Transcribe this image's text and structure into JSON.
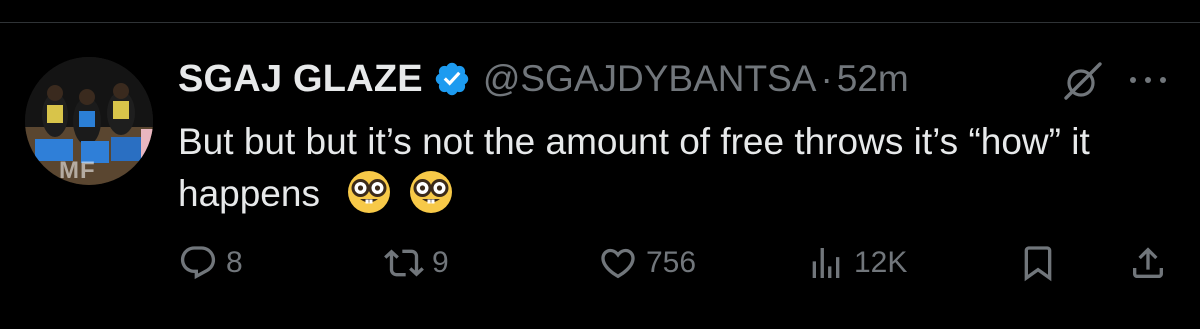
{
  "tweet": {
    "display_name": "SGAJ GLAZE",
    "handle": "@SGAJDYBANTSA",
    "separator": "·",
    "time": "52m",
    "text": "But but but it’s not the amount of free throws it’s “how” it happens",
    "emojis": [
      "nerd-face",
      "nerd-face"
    ],
    "avatar_overlay_text": "MF"
  },
  "actions": {
    "replies": "8",
    "reposts": "9",
    "likes": "756",
    "views": "12K"
  },
  "icons": {
    "verified": "verified-badge-icon",
    "grok": "grok-icon",
    "more": "more-icon",
    "reply": "reply-icon",
    "repost": "repost-icon",
    "like": "heart-icon",
    "views": "views-icon",
    "bookmark": "bookmark-icon",
    "share": "share-icon"
  },
  "colors": {
    "background": "#000000",
    "primary_text": "#e7e9ea",
    "secondary_text": "#71767b",
    "verified_blue": "#1d9bf0"
  }
}
